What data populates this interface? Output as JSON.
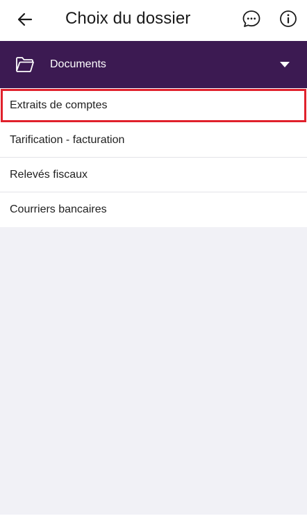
{
  "header": {
    "title": "Choix du dossier",
    "back_icon": "arrow-left-icon",
    "chat_icon": "chat-bubble-icon",
    "info_icon": "info-icon"
  },
  "selector": {
    "label": "Documents",
    "icon": "folder-icon",
    "caret": "caret-down-icon",
    "background": "#3c1a52"
  },
  "list": {
    "items": [
      {
        "label": "Extraits de comptes",
        "highlighted": true
      },
      {
        "label": "Tarification - facturation",
        "highlighted": false
      },
      {
        "label": "Relevés fiscaux",
        "highlighted": false
      },
      {
        "label": "Courriers bancaires",
        "highlighted": false
      }
    ]
  },
  "colors": {
    "accent": "#3c1a52",
    "highlight": "#e0202b",
    "empty_background": "#f1f1f6"
  }
}
